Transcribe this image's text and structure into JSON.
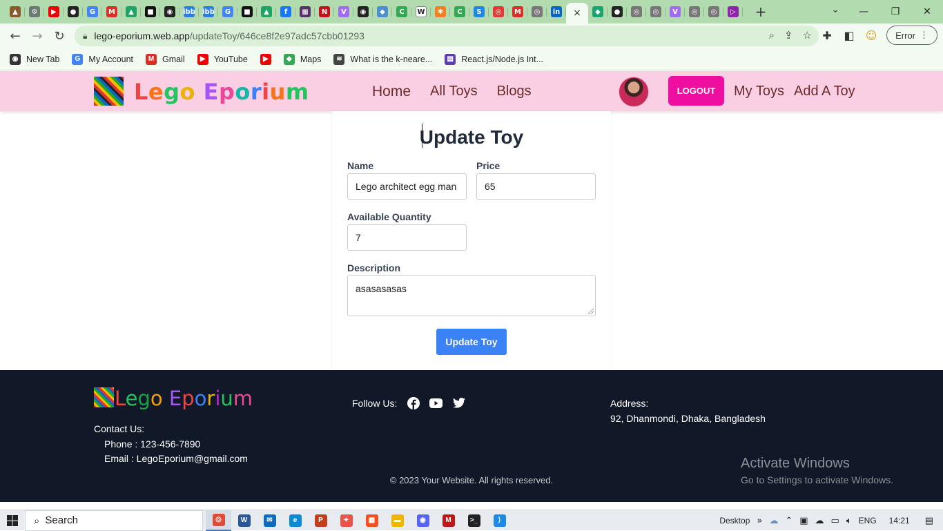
{
  "browser": {
    "tabs": [
      {
        "icon": "acorn-icon",
        "color": "#8a5a2b",
        "glyph": "▲"
      },
      {
        "icon": "chatgpt-icon",
        "color": "#6b7b72",
        "glyph": "⚙"
      },
      {
        "icon": "youtube-icon",
        "color": "#e00",
        "glyph": "▶"
      },
      {
        "icon": "github-icon",
        "color": "#222",
        "glyph": "●"
      },
      {
        "icon": "google-icon",
        "color": "#4285f4",
        "glyph": "G"
      },
      {
        "icon": "gmail-icon",
        "color": "#d93025",
        "glyph": "M"
      },
      {
        "icon": "drive-icon",
        "color": "#1fa463",
        "glyph": "▲"
      },
      {
        "icon": "app-icon",
        "color": "#111",
        "glyph": "■"
      },
      {
        "icon": "globe-icon",
        "color": "#222",
        "glyph": "◉"
      },
      {
        "icon": "ibb-icon",
        "color": "#2a7de1",
        "glyph": "ibb"
      },
      {
        "icon": "ibb-icon",
        "color": "#2a7de1",
        "glyph": "ibb"
      },
      {
        "icon": "google-icon",
        "color": "#4285f4",
        "glyph": "G"
      },
      {
        "icon": "app-icon",
        "color": "#111",
        "glyph": "■"
      },
      {
        "icon": "drive-icon",
        "color": "#1fa463",
        "glyph": "▲"
      },
      {
        "icon": "facebook-icon",
        "color": "#1877f2",
        "glyph": "f"
      },
      {
        "icon": "image-icon",
        "color": "#553366",
        "glyph": "▦"
      },
      {
        "icon": "app-icon",
        "color": "#c4121a",
        "glyph": "N"
      },
      {
        "icon": "vite-icon",
        "color": "#a06bf0",
        "glyph": "V"
      },
      {
        "icon": "globe-icon",
        "color": "#222",
        "glyph": "◉"
      },
      {
        "icon": "app-icon",
        "color": "#4a8fd0",
        "glyph": "◆"
      },
      {
        "icon": "app-icon",
        "color": "#34a853",
        "glyph": "C"
      },
      {
        "icon": "wiki-icon",
        "color": "#fff",
        "glyph": "W"
      },
      {
        "icon": "app-icon",
        "color": "#f48024",
        "glyph": "✱"
      },
      {
        "icon": "app-icon",
        "color": "#34a853",
        "glyph": "C"
      },
      {
        "icon": "app-icon",
        "color": "#1e88e5",
        "glyph": "S"
      },
      {
        "icon": "app-icon",
        "color": "#e53935",
        "glyph": "◎"
      },
      {
        "icon": "gmail-icon",
        "color": "#d93025",
        "glyph": "M"
      },
      {
        "icon": "chrome-icon",
        "color": "#777",
        "glyph": "◎"
      },
      {
        "icon": "linkedin-icon",
        "color": "#0a66c2",
        "glyph": "in"
      }
    ],
    "active_tab": {
      "icon": "close-icon",
      "glyph": "×"
    },
    "tabs_after": [
      {
        "icon": "app-icon",
        "color": "#1aa36f",
        "glyph": "◆"
      },
      {
        "icon": "github-icon",
        "color": "#222",
        "glyph": "●"
      },
      {
        "icon": "chrome-icon",
        "color": "#777",
        "glyph": "◎"
      },
      {
        "icon": "chrome-icon",
        "color": "#777",
        "glyph": "◎"
      },
      {
        "icon": "vite-icon",
        "color": "#a06bf0",
        "glyph": "V"
      },
      {
        "icon": "chrome-icon",
        "color": "#777",
        "glyph": "◎"
      },
      {
        "icon": "chrome-icon",
        "color": "#777",
        "glyph": "◎"
      },
      {
        "icon": "app-icon",
        "color": "#8e24aa",
        "glyph": "▷"
      }
    ],
    "url_host": "lego-eporium.web.app",
    "url_path": "/updateToy/646ce8f2e97adc57cbb01293",
    "profile_status": "Error",
    "bookmarks": [
      {
        "label": "New Tab",
        "icon": "globe-icon",
        "color": "#333",
        "glyph": "◉"
      },
      {
        "label": "My Account",
        "icon": "google-icon",
        "color": "#4285f4",
        "glyph": "G"
      },
      {
        "label": "Gmail",
        "icon": "gmail-icon",
        "color": "#d93025",
        "glyph": "M"
      },
      {
        "label": "YouTube",
        "icon": "youtube-icon",
        "color": "#e00",
        "glyph": "▶"
      },
      {
        "label": "",
        "icon": "youtube-icon",
        "color": "#e00",
        "glyph": "▶"
      },
      {
        "label": "Maps",
        "icon": "maps-icon",
        "color": "#34a853",
        "glyph": "◆"
      },
      {
        "label": "What is the k-neare...",
        "icon": "app-icon",
        "color": "#444",
        "glyph": "≋"
      },
      {
        "label": "React.js/Node.js Int...",
        "icon": "app-icon",
        "color": "#5c3fa8",
        "glyph": "▤"
      }
    ]
  },
  "site": {
    "brand": "Lego Eporium",
    "brand_colors": [
      "#ef4444",
      "#f97316",
      "#22c55e",
      "#eab308",
      "#a855f7",
      "#ec4899",
      "#14b8a6",
      "#3b82f6"
    ],
    "nav": {
      "home": "Home",
      "all_toys": "All Toys",
      "blogs": "Blogs"
    },
    "logout": "LOGOUT",
    "my_toys": "My Toys",
    "add_toy": "Add A Toy",
    "accent": "#ee0fa0"
  },
  "form": {
    "title": "Update Toy",
    "name_label": "Name",
    "name_value": "Lego architect egg man",
    "price_label": "Price",
    "price_value": "65",
    "qty_label": "Available Quantity",
    "qty_value": "7",
    "desc_label": "Description",
    "desc_value": "asasasasas",
    "submit": "Update Toy",
    "submit_color": "#3b82f6"
  },
  "footer": {
    "brand": "Lego Eporium",
    "brand_colors": [
      "#ef4444",
      "#22c55e",
      "#16a34a",
      "#f59e0b",
      "#a855f7",
      "#ef4444",
      "#3b82f6",
      "#eab308",
      "#c026d3",
      "#22c55e",
      "#ec4899",
      "#ef4444"
    ],
    "contact_title": "Contact Us:",
    "phone": "Phone : 123-456-7890",
    "email": "Email : LegoEporium@gmail.com",
    "follow": "Follow Us:",
    "social": [
      "facebook-icon",
      "youtube-icon",
      "twitter-icon"
    ],
    "address_title": "Address:",
    "address": "92, Dhanmondi, Dhaka, Bangladesh",
    "copyright": "© 2023 Your Website. All rights reserved.",
    "activate_title": "Activate Windows",
    "activate_sub": "Go to Settings to activate Windows."
  },
  "taskbar": {
    "search": "Search",
    "apps": [
      {
        "icon": "chrome-icon",
        "color": "#dd4b39",
        "glyph": "◎",
        "active": true
      },
      {
        "icon": "word-icon",
        "color": "#2b579a",
        "glyph": "W"
      },
      {
        "icon": "mail-icon",
        "color": "#0f6cbd",
        "glyph": "✉"
      },
      {
        "icon": "edge-icon",
        "color": "#0c8ad6",
        "glyph": "e"
      },
      {
        "icon": "powerpoint-icon",
        "color": "#c43e1c",
        "glyph": "P"
      },
      {
        "icon": "app-icon",
        "color": "#e8534a",
        "glyph": "✦"
      },
      {
        "icon": "store-icon",
        "color": "#f25022",
        "glyph": "▦"
      },
      {
        "icon": "folder-icon",
        "color": "#f3b400",
        "glyph": "▬"
      },
      {
        "icon": "discord-icon",
        "color": "#5865f2",
        "glyph": "◉"
      },
      {
        "icon": "mcafee-icon",
        "color": "#c01818",
        "glyph": "M"
      },
      {
        "icon": "terminal-icon",
        "color": "#222",
        "glyph": ">_"
      },
      {
        "icon": "vscode-icon",
        "color": "#1e88e5",
        "glyph": "⟩"
      }
    ],
    "desktop": "Desktop",
    "lang": "ENG",
    "time": "14:21"
  }
}
